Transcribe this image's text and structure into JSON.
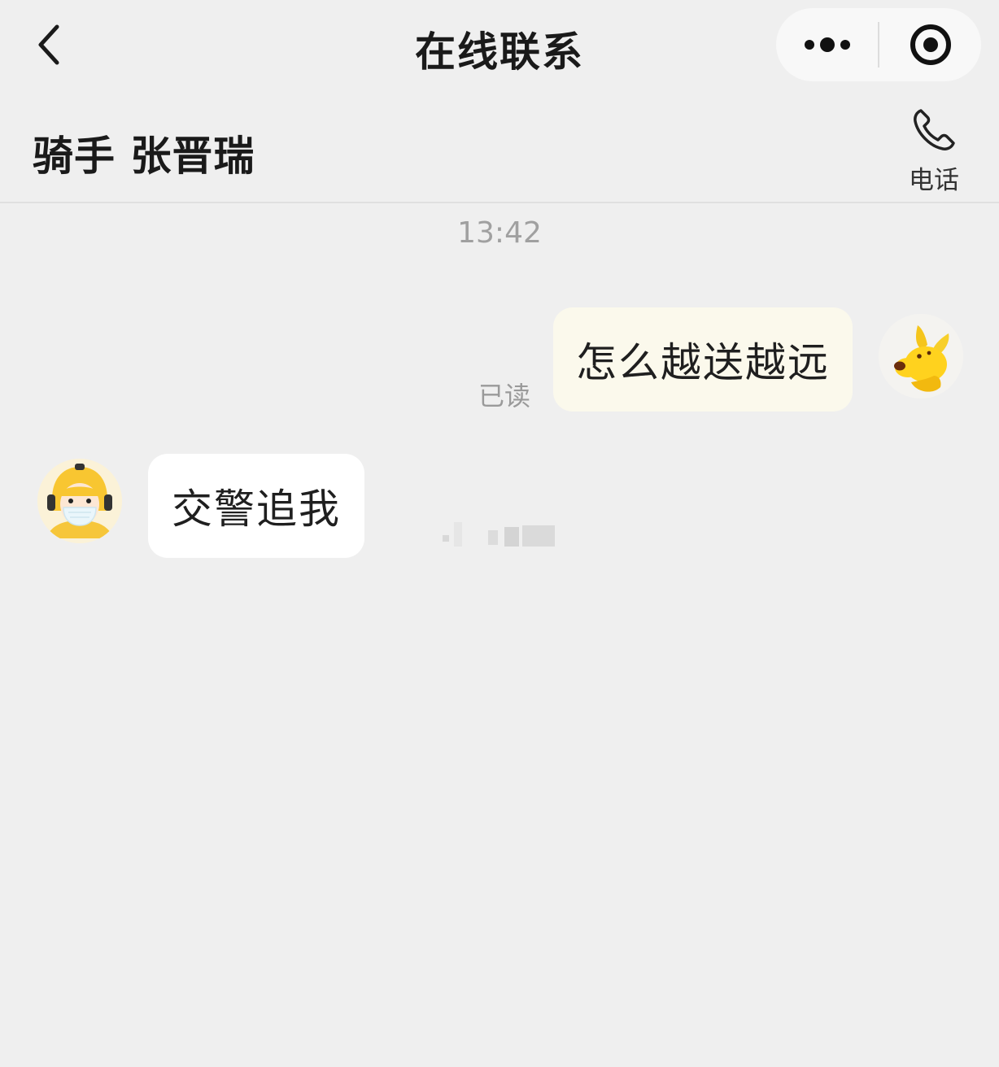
{
  "nav": {
    "title": "在线联系",
    "back_icon": "chevron-left-icon",
    "more_icon": "more-dots-icon",
    "close_icon": "target-circle-icon"
  },
  "header": {
    "rider_name": "骑手 张晋瑞",
    "call_label": "电话",
    "call_icon": "phone-icon"
  },
  "chat": {
    "timestamp": "13:42",
    "messages": [
      {
        "side": "right",
        "text": "怎么越送越远",
        "status": "已读",
        "avatar": "kangaroo-avatar"
      },
      {
        "side": "left",
        "text": "交警追我",
        "avatar": "rider-avatar"
      }
    ]
  },
  "colors": {
    "background": "#efefef",
    "outgoing_bubble": "#fbf9ec",
    "incoming_bubble": "#ffffff",
    "accent_yellow": "#ffd21e"
  }
}
